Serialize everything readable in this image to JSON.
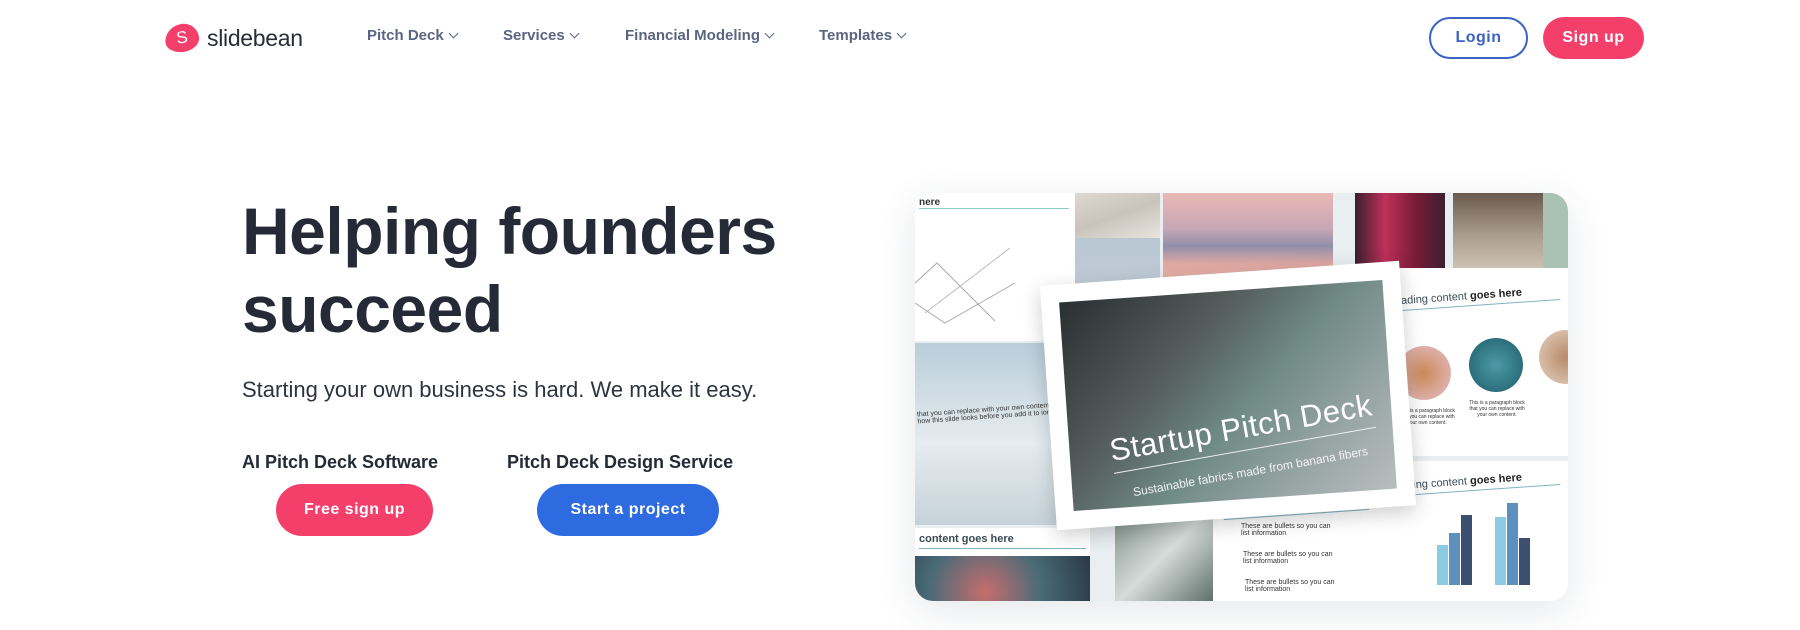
{
  "header": {
    "logo_letter": "S",
    "logo_text": "slidebean",
    "nav": [
      {
        "label": "Pitch Deck"
      },
      {
        "label": "Services"
      },
      {
        "label": "Financial Modeling"
      },
      {
        "label": "Templates"
      }
    ],
    "login_label": "Login",
    "signup_label": "Sign up"
  },
  "hero": {
    "headline_line1": "Helping founders",
    "headline_line2": "succeed",
    "subtitle": "Starting your own business is hard. We make it easy.",
    "software_label": "AI Pitch Deck Software",
    "software_button": "Free sign up",
    "service_label": "Pitch Deck Design Service",
    "service_button": "Start a project"
  },
  "preview": {
    "chart_slide_heading": "nere",
    "sky_slide_text": "that you can replace with your own content. The able to see how this slide looks before you add it to ion.",
    "bottom_left_heading": "content goes here",
    "main_title": "Startup Pitch Deck",
    "main_subtitle": "Sustainable fabrics made from banana fibers",
    "heading_prefix": "Heading content ",
    "heading_bold": "goes here",
    "bullet": "These are bullets so you can list information",
    "circle_caption": "This is a paragraph block that you can replace with your own content."
  },
  "colors": {
    "brand_pink": "#f43f6b",
    "brand_blue": "#2f6be0",
    "login_blue": "#3b63c4",
    "text_dark": "#252a36",
    "nav_gray": "#5a6680"
  }
}
